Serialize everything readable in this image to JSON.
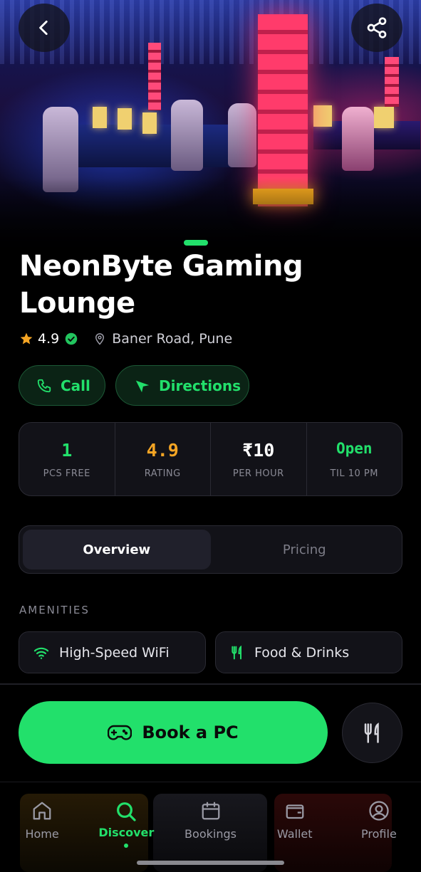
{
  "venue": {
    "name": "NeonByte Gaming Lounge",
    "rating": "4.9",
    "location": "Baner Road, Pune"
  },
  "actions": {
    "call_label": "Call",
    "directions_label": "Directions"
  },
  "stats": [
    {
      "value": "1",
      "label": "PCS FREE",
      "color": "#22e06b"
    },
    {
      "value": "4.9",
      "label": "RATING",
      "color": "#f5a524"
    },
    {
      "value": "₹10",
      "label": "PER HOUR",
      "color": "#ffffff"
    },
    {
      "value": "Open",
      "label": "TIL 10 PM",
      "color": "#22e06b"
    }
  ],
  "tabs": [
    {
      "label": "Overview",
      "active": true
    },
    {
      "label": "Pricing",
      "active": false
    }
  ],
  "amenities": {
    "section_label": "AMENITIES",
    "items": [
      {
        "label": "High-Speed WiFi",
        "icon": "wifi-icon"
      },
      {
        "label": "Food & Drinks",
        "icon": "fork-knife-icon"
      }
    ]
  },
  "cta": {
    "book_label": "Book a PC"
  },
  "nav": [
    {
      "label": "Home",
      "icon": "home-icon",
      "active": false
    },
    {
      "label": "Discover",
      "icon": "search-icon",
      "active": true
    },
    {
      "label": "Bookings",
      "icon": "calendar-icon",
      "active": false
    },
    {
      "label": "Wallet",
      "icon": "wallet-icon",
      "active": false
    },
    {
      "label": "Profile",
      "icon": "user-icon",
      "active": false
    }
  ],
  "colors": {
    "accent": "#22e06b",
    "rating": "#f5a524",
    "background": "#000000",
    "card": "#121218"
  }
}
